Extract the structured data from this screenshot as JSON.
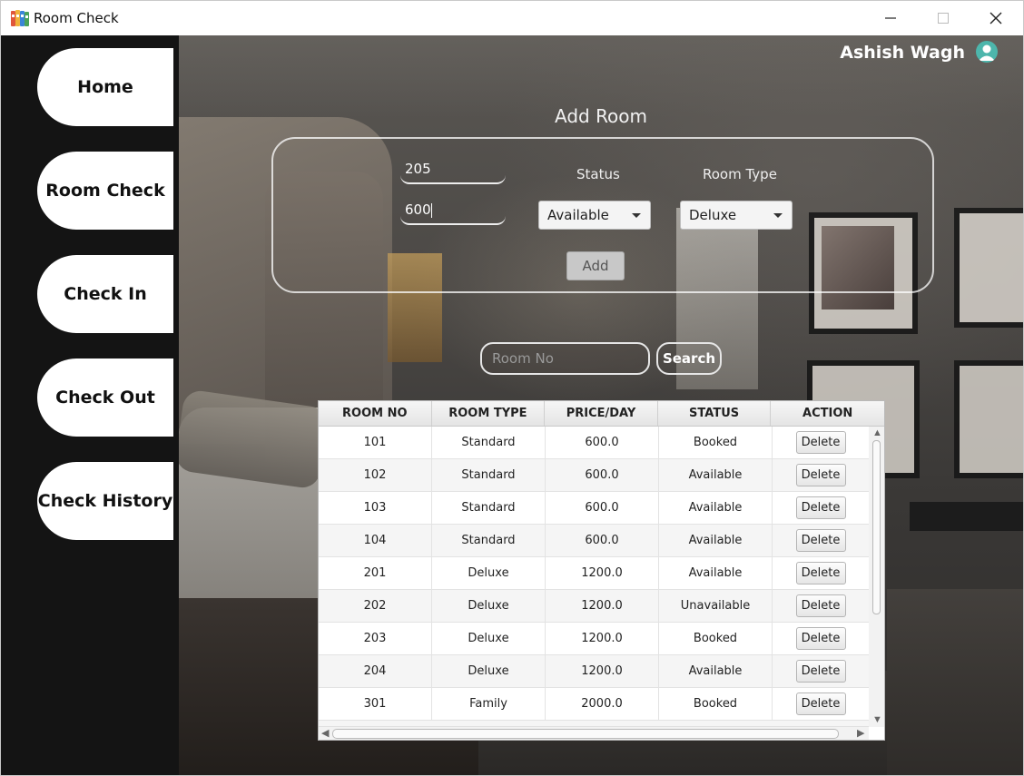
{
  "window": {
    "title": "Room Check",
    "app_icon": "binders-icon",
    "controls": [
      "minimize-icon",
      "maximize-icon",
      "close-icon"
    ]
  },
  "sidebar": {
    "items": [
      {
        "label": "Home"
      },
      {
        "label": "Room Check"
      },
      {
        "label": "Check In"
      },
      {
        "label": "Check Out"
      },
      {
        "label": "Check History"
      }
    ]
  },
  "header": {
    "user_name": "Ashish Wagh",
    "avatar_icon": "user-avatar-icon"
  },
  "add_room": {
    "title": "Add Room",
    "room_no_value": "205",
    "price_value": "600",
    "status_label": "Status",
    "status_value": "Available",
    "room_type_label": "Room Type",
    "room_type_value": "Deluxe",
    "add_label": "Add"
  },
  "search": {
    "placeholder": "Room No",
    "button_label": "Search"
  },
  "table": {
    "columns": [
      "ROOM NO",
      "ROOM TYPE",
      "PRICE/DAY",
      "STATUS",
      "ACTION"
    ],
    "rows": [
      {
        "room_no": "101",
        "room_type": "Standard",
        "price": "600.0",
        "status": "Booked",
        "action": "Delete"
      },
      {
        "room_no": "102",
        "room_type": "Standard",
        "price": "600.0",
        "status": "Available",
        "action": "Delete"
      },
      {
        "room_no": "103",
        "room_type": "Standard",
        "price": "600.0",
        "status": "Available",
        "action": "Delete"
      },
      {
        "room_no": "104",
        "room_type": "Standard",
        "price": "600.0",
        "status": "Available",
        "action": "Delete"
      },
      {
        "room_no": "201",
        "room_type": "Deluxe",
        "price": "1200.0",
        "status": "Available",
        "action": "Delete"
      },
      {
        "room_no": "202",
        "room_type": "Deluxe",
        "price": "1200.0",
        "status": "Unavailable",
        "action": "Delete"
      },
      {
        "room_no": "203",
        "room_type": "Deluxe",
        "price": "1200.0",
        "status": "Booked",
        "action": "Delete"
      },
      {
        "room_no": "204",
        "room_type": "Deluxe",
        "price": "1200.0",
        "status": "Available",
        "action": "Delete"
      },
      {
        "room_no": "301",
        "room_type": "Family",
        "price": "2000.0",
        "status": "Booked",
        "action": "Delete"
      }
    ]
  },
  "colors": {
    "sidebar_bg": "#141414",
    "nav_button_bg": "#ffffff",
    "avatar": "#4db6ac"
  }
}
